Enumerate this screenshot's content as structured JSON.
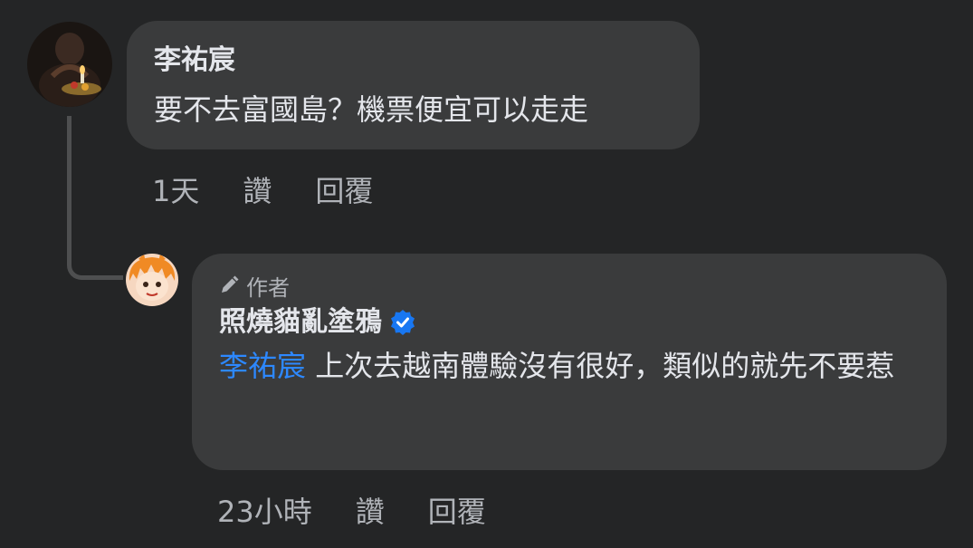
{
  "comment1": {
    "author": "李祐宸",
    "text": "要不去富國島？機票便宜可以走走",
    "time": "1天",
    "like_label": "讚",
    "reply_label": "回覆"
  },
  "comment2": {
    "badge": "作者",
    "author": "照燒貓亂塗鴉",
    "mention": "李祐宸",
    "text": " 上次去越南體驗沒有很好，類似的就先不要惹",
    "time": "23小時",
    "like_label": "讚",
    "reply_label": "回覆"
  },
  "colors": {
    "background": "#242526",
    "bubble": "#3a3b3c",
    "mention": "#2d88ff",
    "verified": "#1877f2",
    "muted_text": "#b0b3b8"
  }
}
